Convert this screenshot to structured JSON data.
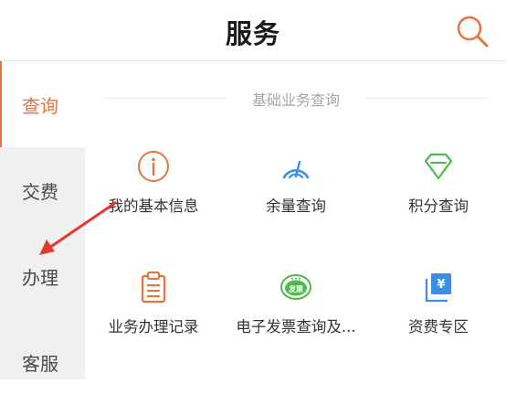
{
  "header": {
    "title": "服务",
    "search_icon": "search-icon"
  },
  "sidebar": {
    "items": [
      {
        "label": "查询",
        "active": true
      },
      {
        "label": "交费",
        "active": false
      },
      {
        "label": "办理",
        "active": false
      },
      {
        "label": "客服",
        "active": false
      }
    ]
  },
  "section": {
    "title": "基础业务查询",
    "items": [
      {
        "label": "我的基本信息",
        "icon": "info-icon"
      },
      {
        "label": "余量查询",
        "icon": "gauge-icon"
      },
      {
        "label": "积分查询",
        "icon": "diamond-icon"
      },
      {
        "label": "业务办理记录",
        "icon": "clipboard-icon"
      },
      {
        "label": "电子发票查询及...",
        "icon": "invoice-icon",
        "icon_text": "发票"
      },
      {
        "label": "资费专区",
        "icon": "tariff-icon",
        "icon_text": "¥"
      }
    ]
  },
  "colors": {
    "accent_orange": "#e8733a",
    "icon_blue": "#3a8ee6",
    "icon_green": "#4cbb4a",
    "annotation_red": "#e03a2c"
  }
}
